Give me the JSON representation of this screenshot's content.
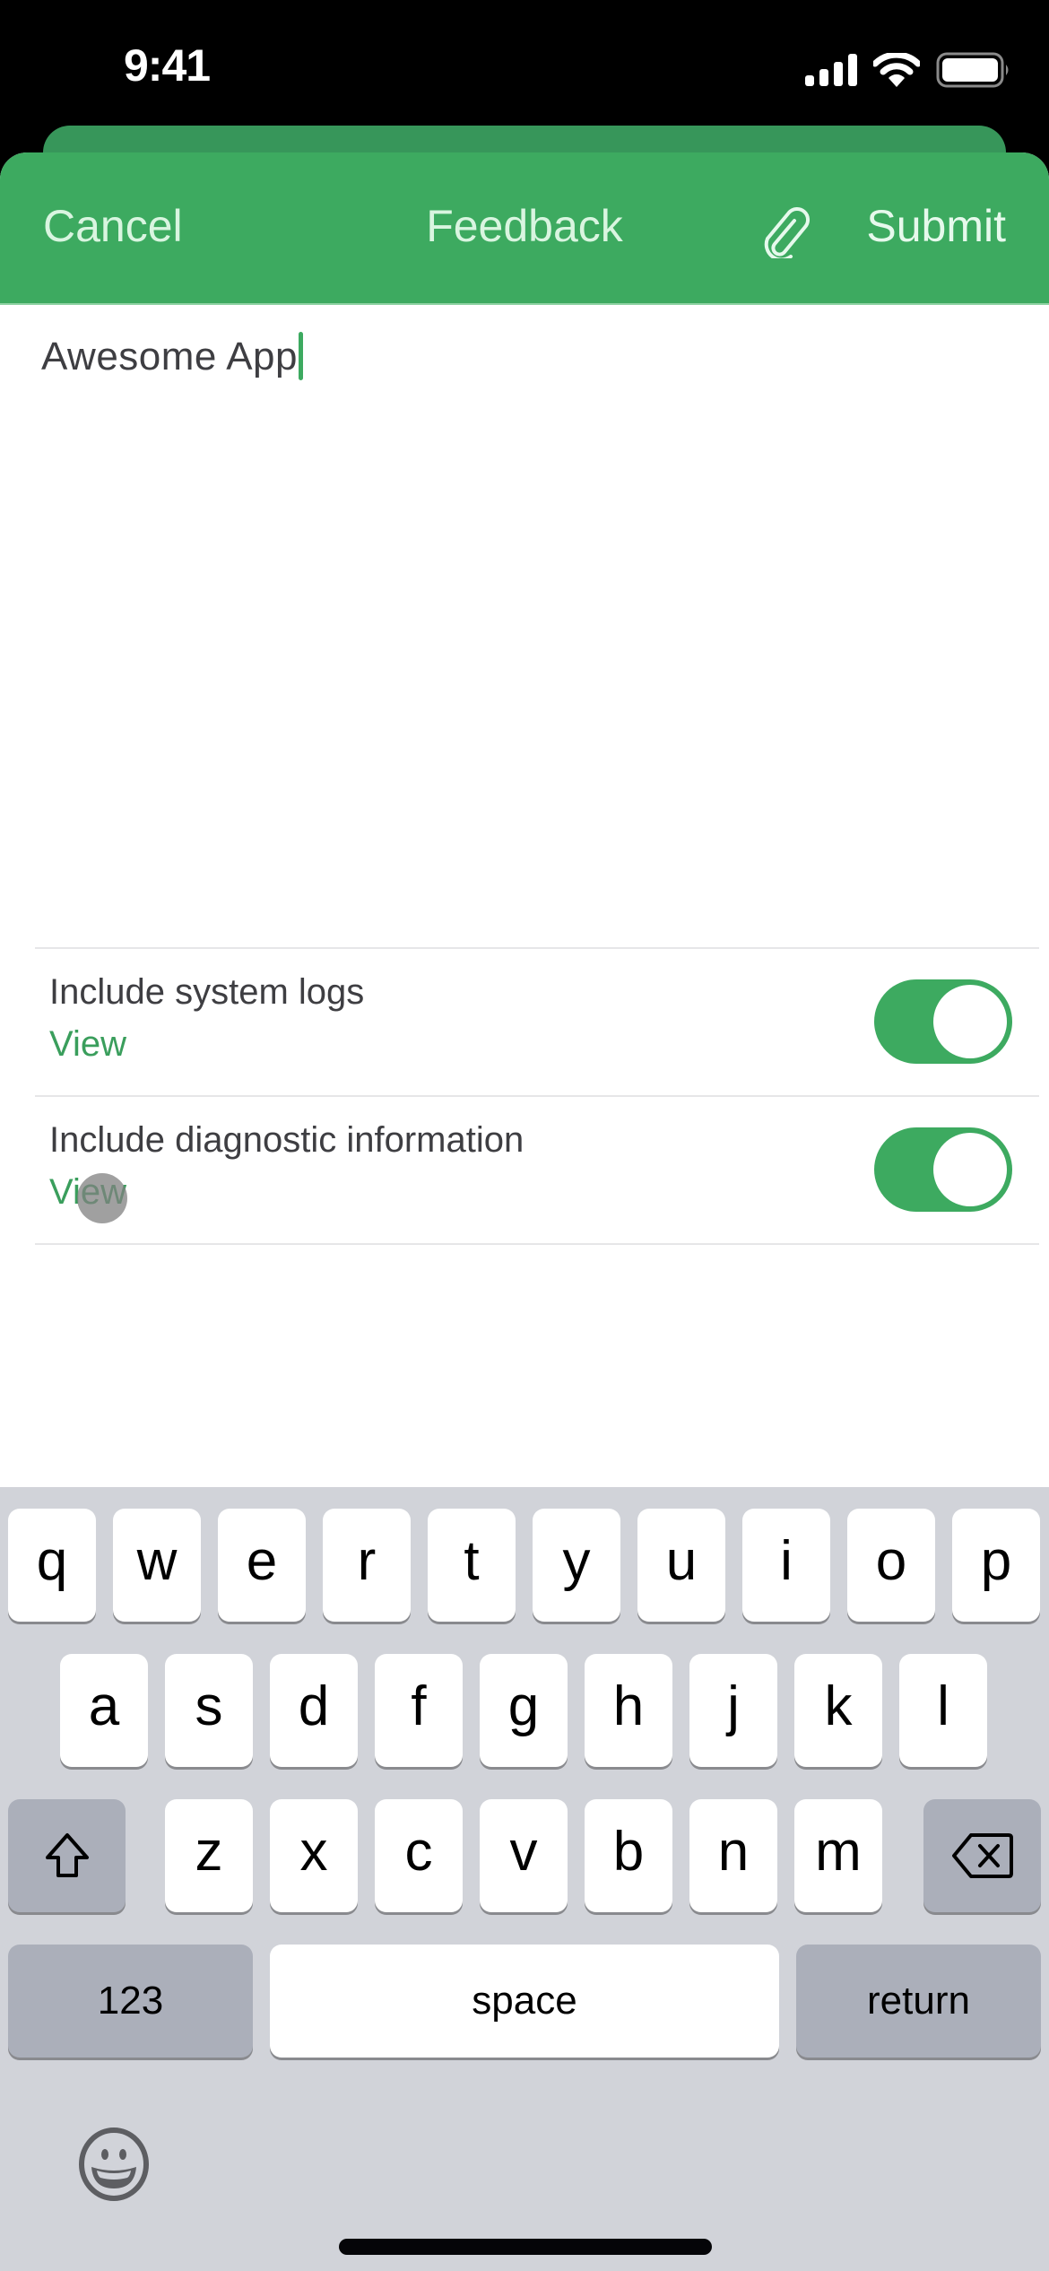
{
  "status_bar": {
    "time": "9:41",
    "icons": [
      "cellular-signal-icon",
      "wifi-icon",
      "battery-icon"
    ]
  },
  "nav": {
    "cancel_label": "Cancel",
    "title": "Feedback",
    "attach_icon": "paperclip-icon",
    "submit_label": "Submit"
  },
  "feedback_text": {
    "value": "Awesome App",
    "placeholder": ""
  },
  "options": [
    {
      "title": "Include system logs",
      "link_label": "View",
      "enabled": true
    },
    {
      "title": "Include diagnostic information",
      "link_label": "View",
      "enabled": true
    }
  ],
  "keyboard": {
    "row1": [
      "q",
      "w",
      "e",
      "r",
      "t",
      "y",
      "u",
      "i",
      "o",
      "p"
    ],
    "row2": [
      "a",
      "s",
      "d",
      "f",
      "g",
      "h",
      "j",
      "k",
      "l"
    ],
    "row3": [
      "z",
      "x",
      "c",
      "v",
      "b",
      "n",
      "m"
    ],
    "shift_icon": "shift-icon",
    "delete_icon": "delete-backspace-icon",
    "numbers_label": "123",
    "space_label": "space",
    "return_label": "return",
    "emoji_icon": "emoji-smiley-icon"
  },
  "colors": {
    "accent": "#3DAA60",
    "accent_dark": "#37965A",
    "link": "#3A9E5C",
    "keyboard_bg": "#D1D3D9",
    "function_key": "#ABAFBA"
  }
}
